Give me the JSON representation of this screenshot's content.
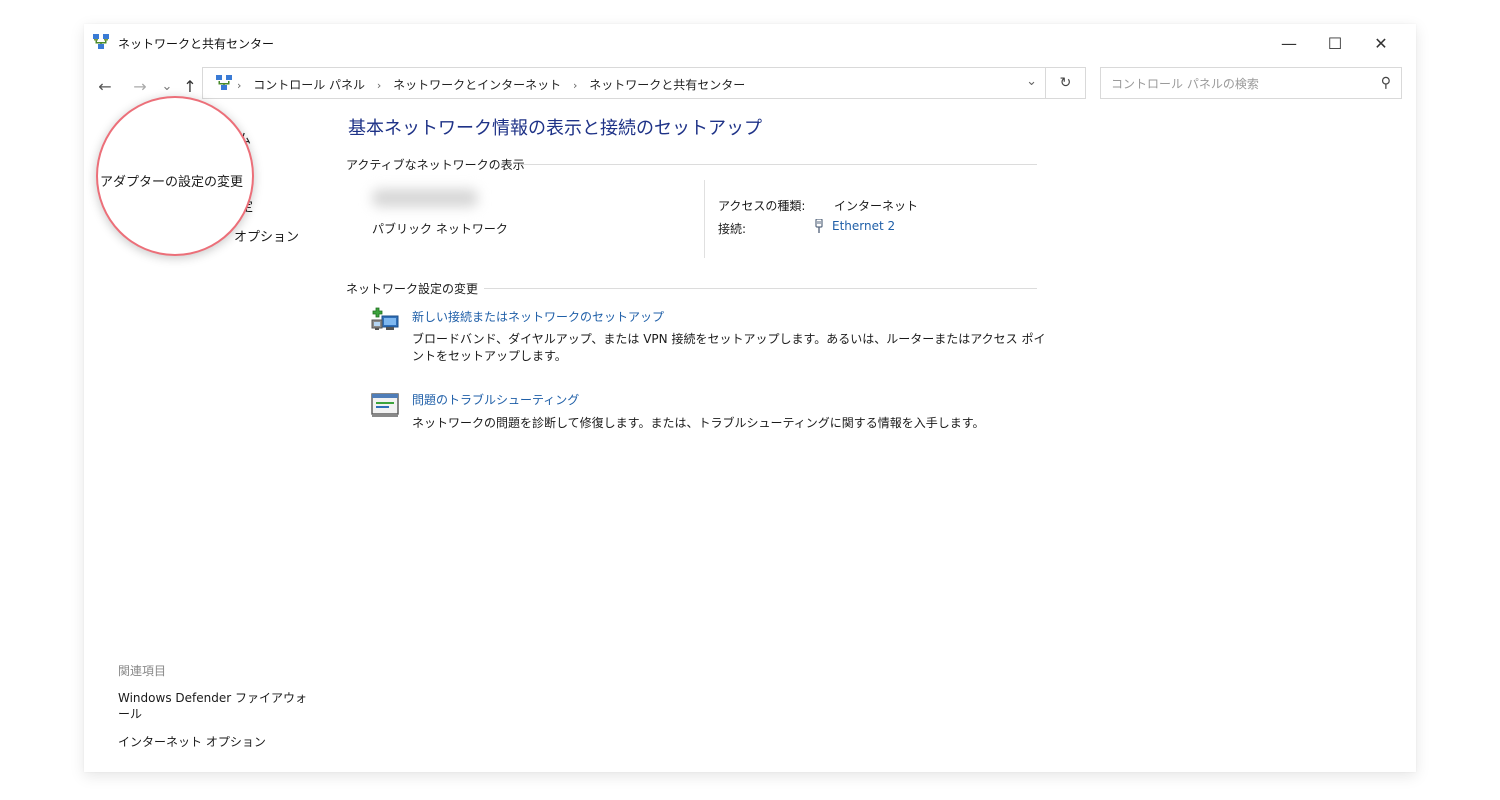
{
  "window": {
    "title": "ネットワークと共有センター",
    "controls": {
      "minimize": "—",
      "maximize": "☐",
      "close": "✕"
    }
  },
  "nav": {
    "back": "←",
    "forward": "→",
    "recent": "⌄",
    "up": "↑",
    "breadcrumbs": [
      "コントロール パネル",
      "ネットワークとインターネット",
      "ネットワークと共有センター"
    ],
    "crumb_separator": "›",
    "dropdown": "⌄",
    "refresh": "↻"
  },
  "search": {
    "placeholder": "コントロール パネルの検索",
    "icon": "⚲"
  },
  "left_pane": {
    "link_partial_top": "ム",
    "highlighted_link": "アダプターの設定の変更",
    "link_partial_middle": "定",
    "link_partial_bottom": "オプション",
    "related_title": "関連項目",
    "related_items": [
      "Windows Defender ファイアウォール",
      "インターネット オプション"
    ]
  },
  "main": {
    "title": "基本ネットワーク情報の表示と接続のセットアップ",
    "active_networks_header": "アクティブなネットワークの表示",
    "network_type": "パブリック ネットワーク",
    "access_type_label": "アクセスの種類:",
    "access_type_value": "インターネット",
    "connection_label": "接続:",
    "connection_value": "Ethernet 2",
    "change_settings_header": "ネットワーク設定の変更",
    "actions": [
      {
        "title": "新しい接続またはネットワークのセットアップ",
        "description": "ブロードバンド、ダイヤルアップ、または VPN 接続をセットアップします。あるいは、ルーターまたはアクセス ポイントをセットアップします。",
        "icon": "new-connection-icon"
      },
      {
        "title": "問題のトラブルシューティング",
        "description": "ネットワークの問題を診断して修復します。または、トラブルシューティングに関する情報を入手します。",
        "icon": "troubleshoot-icon"
      }
    ]
  },
  "colors": {
    "link": "#1f5fa8",
    "title": "#1e3287",
    "highlight_ring": "#ec6f79"
  }
}
